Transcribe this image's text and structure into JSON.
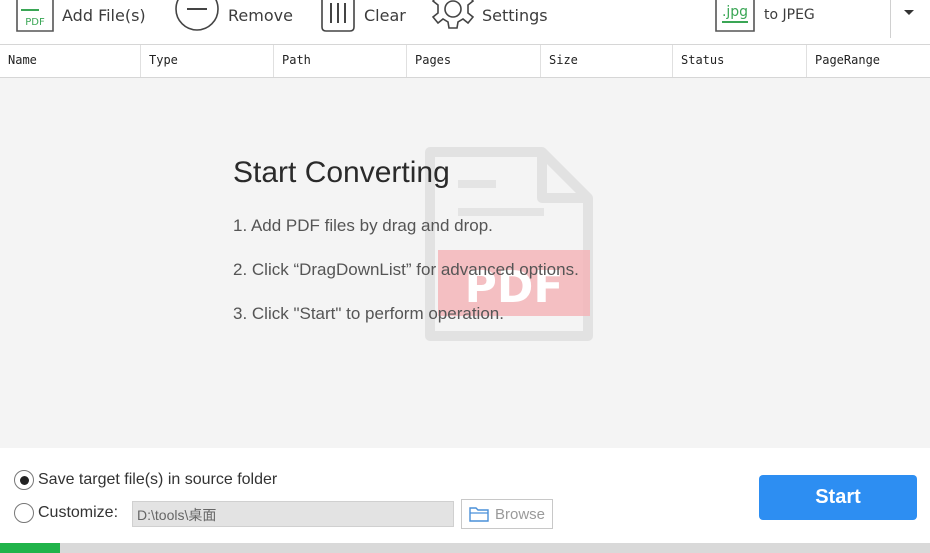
{
  "toolbar": {
    "add_files": "Add File(s)",
    "add_icon_text": "PDF",
    "remove": "Remove",
    "clear": "Clear",
    "settings": "Settings",
    "format_icon_text": ".jpg",
    "format_label": "to JPEG"
  },
  "table": {
    "columns": [
      "Name",
      "Type",
      "Path",
      "Pages",
      "Size",
      "Status",
      "PageRange"
    ]
  },
  "guide": {
    "title": "Start Converting",
    "steps": [
      "1. Add PDF files by drag and drop.",
      "2. Click “DragDownList” for advanced options.",
      "3. Click \"Start\" to perform operation."
    ],
    "watermark_text": "PDF"
  },
  "output": {
    "save_source_label": "Save target file(s) in source folder",
    "save_source_selected": true,
    "customize_label": "Customize:",
    "customize_selected": false,
    "path_value": "D:\\tools\\桌面",
    "browse_label": "Browse"
  },
  "start_label": "Start",
  "progress": {
    "fraction": 0.065
  },
  "colors": {
    "accent": "#2d8ef2",
    "progress": "#20b34a",
    "icon_green": "#3aa655",
    "watermark_red": "#f3b5b8"
  }
}
